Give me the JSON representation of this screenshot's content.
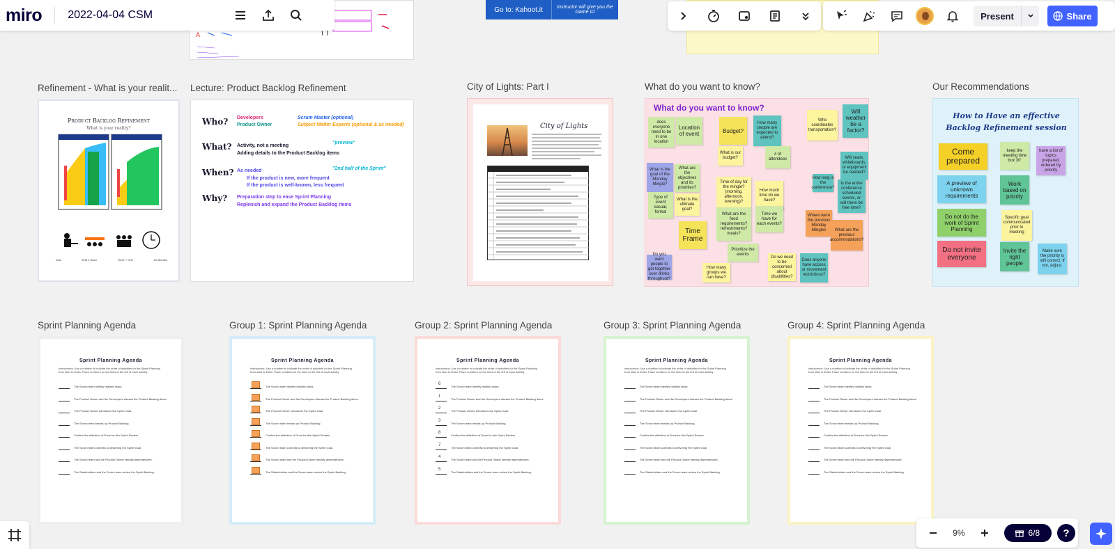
{
  "app": {
    "logo": "miro",
    "board_title": "2022-04-04 CSM",
    "colors": {
      "accent": "#4262ff",
      "canvas": "#f1f1f1"
    }
  },
  "left_toolbar_icons": [
    "menu-icon",
    "export-icon",
    "search-icon"
  ],
  "top_center_toolbar": {
    "icons": [
      "chevron-right-icon",
      "timer-icon",
      "card-icon",
      "notes-icon",
      "chevron-down-double-icon"
    ]
  },
  "top_right_toolbar": {
    "icons": [
      "cursor-reaction-icon",
      "celebrate-icon",
      "comment-icon",
      "avatar",
      "bell-icon"
    ],
    "present_label": "Present",
    "share_label": "Share"
  },
  "kahoot_banner": {
    "left": "Go to: Kahoot.it",
    "right": "Instructor will give you the Game ID"
  },
  "frames": [
    {
      "label": "Refinement - What is your realit..."
    },
    {
      "label": "Lecture: Product Backlog Refinement"
    },
    {
      "label": "City of Lights: Part I"
    },
    {
      "label": "What do you want to know?"
    },
    {
      "label": "Our Recommendations"
    },
    {
      "label": "Sprint Planning Agenda"
    },
    {
      "label": "Group 1: Sprint Planning Agenda"
    },
    {
      "label": "Group 2: Sprint Planning Agenda"
    },
    {
      "label": "Group 3: Sprint Planning Agenda"
    },
    {
      "label": "Group 4: Sprint Planning Agenda"
    }
  ],
  "refinement": {
    "title": "Product Backlog Refinement",
    "subtitle": "What is your reality?",
    "legend": [
      "Solo",
      "Entire Team",
      "Three + One",
      "15 Minutes"
    ]
  },
  "lecture": {
    "who_label": "Who?",
    "who_developers": "Developers",
    "who_product_owner": "Product Owner",
    "who_scrum_master": "Scrum Master (optional)",
    "who_sme": "Subject Matter Experts (optional & as needed)",
    "what_label": "What?",
    "what_line1": "Activity, not a meeting",
    "what_preview": "\"preview\"",
    "what_line2": "Adding details to the Product Backlog items",
    "when_label": "When?",
    "when_line1": "As needed",
    "when_half": "\"2nd half of the Sprint\"",
    "when_b1": "If the product is new, more frequent",
    "when_b2": "If the product is well-known, less frequent",
    "why_label": "Why?",
    "why_line1": "Preparation step to ease Sprint Planning",
    "why_line2": "Replenish and expand the Product Backlog items"
  },
  "city": {
    "title": "City of Lights"
  },
  "know": {
    "heading": "What do you want to know?",
    "stickies": [
      "does everyone need to be in one location",
      "Location of event",
      "Budget?",
      "How many people are expected to attend?",
      "Who coordinates transportation?",
      "Will weather be a factor?",
      "What is our budget?",
      "# of attendees",
      "Will seats, whiteboards, or equipment be needed?",
      "What is the goal of the Monday Mingle?",
      "What are the objectives and its priorities?",
      "Time of day for the mingle? (morning, afternoon, evening)?",
      "How much time do we have?",
      "How long is the conference?",
      "Is the entire conference scheduled events, or will there be free time?",
      "Type of event casual, formal",
      "What is the ultimate goal?",
      "What are the food requirements? refreshments? meals?",
      "Time we have for each events?",
      "Where were the previous Monday Mingles",
      "What are the previous accommodations?",
      "Time Frame",
      "Prioritize the events",
      "Do you want people to get together over drinks throughout?",
      "How many groups we can have?",
      "Do we need to be concerned about disabilities?",
      "Does anyone have access or movement restrictions?"
    ]
  },
  "recommend": {
    "title": "How to Have an effective Backlog Refinement session",
    "stickies": [
      "Come prepared",
      "keep the meeting time box 30'",
      "have a list of topics prepared, ordered by priority",
      "A preview of unknown requirements",
      "Work based on priority",
      "Do not do the work of Sprint Planning",
      "Specific goal communicated prior to meeting",
      "Do not invite everyone",
      "Invite the right people",
      "Make sure the priority is still correct. If not, adjust."
    ]
  },
  "agenda": {
    "title": "Sprint Planning Agenda",
    "instructions": "Instructions: Use a number to indicate the order of activities for the Sprint Planning from start to finish. Place numbers on the lines to the left of each activity.",
    "items": [
      "The Scrum team identify realistic tasks.",
      "The Product Owner and the Developers discuss the Product Backlog items.",
      "The Product Owner introduces the Sprint Goal.",
      "The Scrum team breaks up Product Backlog.",
      "Confirm the definition of Done for this Sprint Review.",
      "The Scrum team commits to delivering the Sprint Goal.",
      "The Scrum team and the Product Owner identify dependencies.",
      "The Stakeholders and the Scrum team review the Sprint Backlog."
    ],
    "group2_numbers": [
      "6",
      "1",
      "2",
      "3",
      "8",
      "7",
      "4",
      "5"
    ]
  },
  "bottom": {
    "zoom": "9%",
    "pages": "6/8"
  }
}
